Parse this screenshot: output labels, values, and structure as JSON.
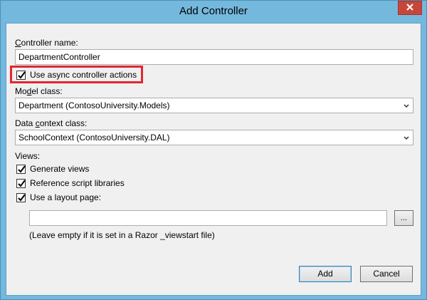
{
  "window": {
    "title": "Add Controller"
  },
  "controller_name": {
    "label": "Controller name:",
    "mnemonic": "C",
    "rest": "ontroller name:",
    "value": "DepartmentController"
  },
  "async_option": {
    "label": "Use async controller actions",
    "checked": true
  },
  "model_class": {
    "label_pre": "Mo",
    "label_mn": "d",
    "label_post": "el class:",
    "selected": "Department (ContosoUniversity.Models)"
  },
  "data_context": {
    "label_pre": "Data ",
    "label_mn": "c",
    "label_post": "ontext class:",
    "selected": "SchoolContext (ContosoUniversity.DAL)"
  },
  "views": {
    "label": "Views:",
    "options": [
      {
        "label": "Generate views",
        "checked": true
      },
      {
        "label": "Reference script libraries",
        "checked": true
      },
      {
        "label": "Use a layout page:",
        "checked": true
      }
    ],
    "layout_path_value": "",
    "browse_label": "...",
    "hint": "(Leave empty if it is set in a Razor _viewstart file)"
  },
  "buttons": {
    "add": "Add",
    "cancel": "Cancel"
  },
  "colors": {
    "frame": "#74b8dd",
    "highlight": "#e4262d",
    "close": "#c7463a"
  },
  "icons": {
    "close": "close-icon",
    "dropdown": "chevron-down-icon",
    "check": "checkmark-icon"
  }
}
